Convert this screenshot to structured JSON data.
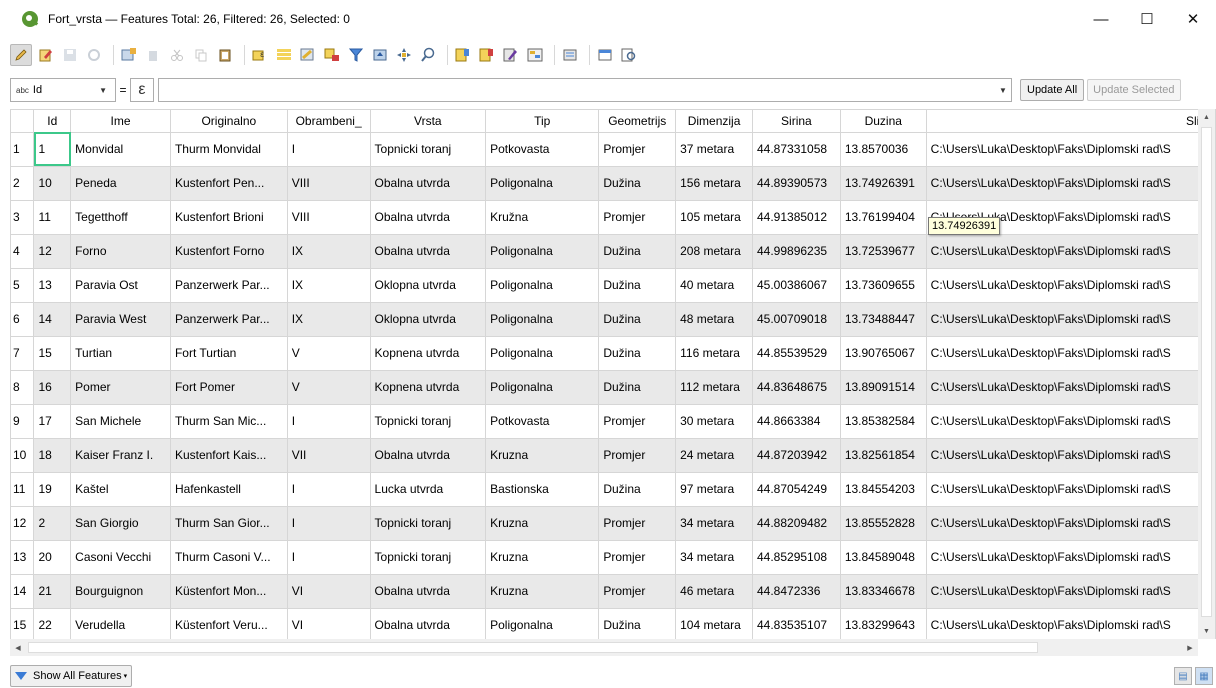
{
  "window": {
    "title": "Fort_vrsta — Features Total: 26, Filtered: 26, Selected: 0",
    "minimize": "—",
    "maximize": "☐",
    "close": "✕"
  },
  "toolbar": {
    "icons": [
      "pencil-icon",
      "multi-edit-icon",
      "save-edits-icon",
      "reload-icon",
      "add-feature-icon",
      "delete-feature-icon",
      "cut-icon",
      "copy-icon",
      "paste-icon",
      "expression-select-icon",
      "select-all-icon",
      "invert-selection-icon",
      "deselect-icon",
      "filter-selected-icon",
      "move-to-top-icon",
      "pan-to-selected-icon",
      "zoom-to-selected-icon",
      "new-field-icon",
      "delete-field-icon",
      "field-calculator-icon",
      "conditional-formatting-icon",
      "actions-icon",
      "dock-icon",
      "form-view-icon"
    ]
  },
  "expression": {
    "field_type": "abc",
    "field_name": "Id",
    "equals": "=",
    "epsilon": "ε",
    "update_all": "Update All",
    "update_selected": "Update Selected"
  },
  "table": {
    "columns": [
      "Id",
      "Ime",
      "Originalno",
      "Obrambeni_",
      "Vrsta",
      "Tip",
      "Geometrijs",
      "Dimenzija",
      "Sirina",
      "Duzina",
      "Slika"
    ],
    "rows": [
      {
        "n": "1",
        "cells": [
          "1",
          "Monvidal",
          "Thurm Monvidal",
          "I",
          "Topnicki toranj",
          "Potkovasta",
          "Promjer",
          "37 metara",
          "44.87331058",
          "13.8570036",
          "C:\\Users\\Luka\\Desktop\\Faks\\Diplomski rad\\S"
        ]
      },
      {
        "n": "2",
        "cells": [
          "10",
          "Peneda",
          "Kustenfort Pen...",
          "VIII",
          "Obalna utvrda",
          "Poligonalna",
          "Dužina",
          "156 metara",
          "44.89390573",
          "13.74926391",
          "C:\\Users\\Luka\\Desktop\\Faks\\Diplomski rad\\S"
        ]
      },
      {
        "n": "3",
        "cells": [
          "11",
          "Tegetthoff",
          "Kustenfort Brioni",
          "VIII",
          "Obalna utvrda",
          "Kružna",
          "Promjer",
          "105 metara",
          "44.91385012",
          "13.76199404",
          "C:\\Users\\Luka\\Desktop\\Faks\\Diplomski rad\\S"
        ]
      },
      {
        "n": "4",
        "cells": [
          "12",
          "Forno",
          "Kustenfort Forno",
          "IX",
          "Obalna utvrda",
          "Poligonalna",
          "Dužina",
          "208 metara",
          "44.99896235",
          "13.72539677",
          "C:\\Users\\Luka\\Desktop\\Faks\\Diplomski rad\\S"
        ]
      },
      {
        "n": "5",
        "cells": [
          "13",
          "Paravia Ost",
          "Panzerwerk Par...",
          "IX",
          "Oklopna utvrda",
          "Poligonalna",
          "Dužina",
          "40 metara",
          "45.00386067",
          "13.73609655",
          "C:\\Users\\Luka\\Desktop\\Faks\\Diplomski rad\\S"
        ]
      },
      {
        "n": "6",
        "cells": [
          "14",
          "Paravia West",
          "Panzerwerk Par...",
          "IX",
          "Oklopna utvrda",
          "Poligonalna",
          "Dužina",
          "48 metara",
          "45.00709018",
          "13.73488447",
          "C:\\Users\\Luka\\Desktop\\Faks\\Diplomski rad\\S"
        ]
      },
      {
        "n": "7",
        "cells": [
          "15",
          "Turtian",
          "Fort Turtian",
          "V",
          "Kopnena utvrda",
          "Poligonalna",
          "Dužina",
          "116 metara",
          "44.85539529",
          "13.90765067",
          "C:\\Users\\Luka\\Desktop\\Faks\\Diplomski rad\\S"
        ]
      },
      {
        "n": "8",
        "cells": [
          "16",
          "Pomer",
          "Fort Pomer",
          "V",
          "Kopnena utvrda",
          "Poligonalna",
          "Dužina",
          "112 metara",
          "44.83648675",
          "13.89091514",
          "C:\\Users\\Luka\\Desktop\\Faks\\Diplomski rad\\S"
        ]
      },
      {
        "n": "9",
        "cells": [
          "17",
          "San Michele",
          "Thurm San Mic...",
          "I",
          "Topnicki toranj",
          "Potkovasta",
          "Promjer",
          "30 metara",
          "44.8663384",
          "13.85382584",
          "C:\\Users\\Luka\\Desktop\\Faks\\Diplomski rad\\S"
        ]
      },
      {
        "n": "10",
        "cells": [
          "18",
          "Kaiser Franz I.",
          "Kustenfort Kais...",
          "VII",
          "Obalna utvrda",
          "Kruzna",
          "Promjer",
          "24 metara",
          "44.87203942",
          "13.82561854",
          "C:\\Users\\Luka\\Desktop\\Faks\\Diplomski rad\\S"
        ]
      },
      {
        "n": "11",
        "cells": [
          "19",
          "Kaštel",
          "Hafenkastell",
          "I",
          "Lucka utvrda",
          "Bastionska",
          "Dužina",
          "97 metara",
          "44.87054249",
          "13.84554203",
          "C:\\Users\\Luka\\Desktop\\Faks\\Diplomski rad\\S"
        ]
      },
      {
        "n": "12",
        "cells": [
          "2",
          "San Giorgio",
          "Thurm San Gior...",
          "I",
          "Topnicki toranj",
          "Kruzna",
          "Promjer",
          "34 metara",
          "44.88209482",
          "13.85552828",
          "C:\\Users\\Luka\\Desktop\\Faks\\Diplomski rad\\S"
        ]
      },
      {
        "n": "13",
        "cells": [
          "20",
          "Casoni Vecchi",
          "Thurm Casoni V...",
          "I",
          "Topnicki toranj",
          "Kruzna",
          "Promjer",
          "34 metara",
          "44.85295108",
          "13.84589048",
          "C:\\Users\\Luka\\Desktop\\Faks\\Diplomski rad\\S"
        ]
      },
      {
        "n": "14",
        "cells": [
          "21",
          "Bourguignon",
          "Küstenfort Mon...",
          "VI",
          "Obalna utvrda",
          "Kruzna",
          "Promjer",
          "46 metara",
          "44.8472336",
          "13.83346678",
          "C:\\Users\\Luka\\Desktop\\Faks\\Diplomski rad\\S"
        ]
      },
      {
        "n": "15",
        "cells": [
          "22",
          "Verudella",
          "Küstenfort Veru...",
          "VI",
          "Obalna utvrda",
          "Poligonalna",
          "Dužina",
          "104 metara",
          "44.83535107",
          "13.83299643",
          "C:\\Users\\Luka\\Desktop\\Faks\\Diplomski rad\\S"
        ]
      }
    ]
  },
  "tooltip": "13.74926391",
  "bottom": {
    "show_features": "Show All Features"
  }
}
